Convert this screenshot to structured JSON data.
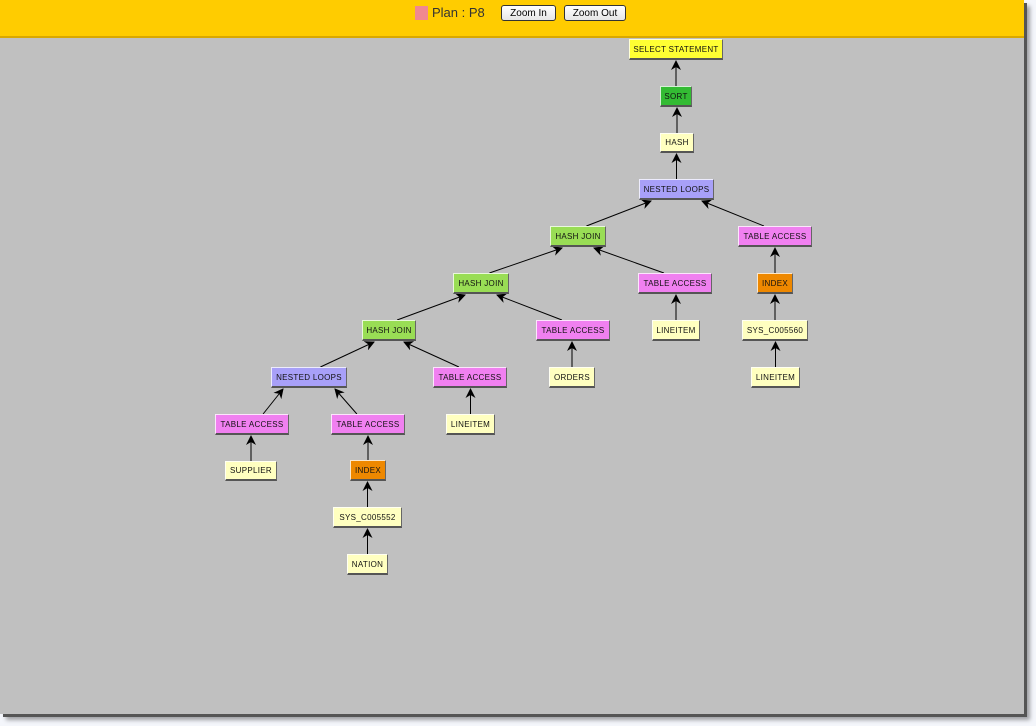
{
  "toolbar": {
    "plan_label": "Plan : P8",
    "legend_color": "#f08890",
    "zoom_in_label": "Zoom In",
    "zoom_out_label": "Zoom Out"
  },
  "node_colors": {
    "select": "#ffff33",
    "sort": "#33bb33",
    "object": "#ffffc0",
    "nested_loops": "#a8a0f8",
    "hash_join": "#99dd55",
    "table_access": "#f080f0",
    "index": "#ee8800"
  },
  "nodes": [
    {
      "id": "n1",
      "label": "SELECT STATEMENT",
      "kind": "select",
      "parent": null
    },
    {
      "id": "n2",
      "label": "SORT",
      "kind": "sort",
      "parent": "n1"
    },
    {
      "id": "n3",
      "label": "HASH",
      "kind": "object",
      "parent": "n2"
    },
    {
      "id": "n4",
      "label": "NESTED LOOPS",
      "kind": "nested_loops",
      "parent": "n3"
    },
    {
      "id": "n5",
      "label": "HASH JOIN",
      "kind": "hash_join",
      "parent": "n4"
    },
    {
      "id": "n6",
      "label": "TABLE ACCESS",
      "kind": "table_access",
      "parent": "n4"
    },
    {
      "id": "n7",
      "label": "HASH JOIN",
      "kind": "hash_join",
      "parent": "n5"
    },
    {
      "id": "n8",
      "label": "TABLE ACCESS",
      "kind": "table_access",
      "parent": "n5"
    },
    {
      "id": "n9",
      "label": "INDEX",
      "kind": "index",
      "parent": "n6"
    },
    {
      "id": "n10",
      "label": "HASH JOIN",
      "kind": "hash_join",
      "parent": "n7"
    },
    {
      "id": "n11",
      "label": "TABLE ACCESS",
      "kind": "table_access",
      "parent": "n7"
    },
    {
      "id": "n12",
      "label": "LINEITEM",
      "kind": "object",
      "parent": "n8"
    },
    {
      "id": "n13",
      "label": "SYS_C005560",
      "kind": "object",
      "parent": "n9"
    },
    {
      "id": "n14",
      "label": "NESTED LOOPS",
      "kind": "nested_loops",
      "parent": "n10"
    },
    {
      "id": "n15",
      "label": "TABLE ACCESS",
      "kind": "table_access",
      "parent": "n10"
    },
    {
      "id": "n16",
      "label": "ORDERS",
      "kind": "object",
      "parent": "n11"
    },
    {
      "id": "n17",
      "label": "LINEITEM",
      "kind": "object",
      "parent": "n13"
    },
    {
      "id": "n18",
      "label": "TABLE ACCESS",
      "kind": "table_access",
      "parent": "n14"
    },
    {
      "id": "n19",
      "label": "TABLE ACCESS",
      "kind": "table_access",
      "parent": "n14"
    },
    {
      "id": "n20",
      "label": "LINEITEM",
      "kind": "object",
      "parent": "n15"
    },
    {
      "id": "n21",
      "label": "SUPPLIER",
      "kind": "object",
      "parent": "n18"
    },
    {
      "id": "n22",
      "label": "INDEX",
      "kind": "index",
      "parent": "n19"
    },
    {
      "id": "n23",
      "label": "SYS_C005552",
      "kind": "object",
      "parent": "n22"
    },
    {
      "id": "n24",
      "label": "NATION",
      "kind": "object",
      "parent": "n23"
    }
  ]
}
